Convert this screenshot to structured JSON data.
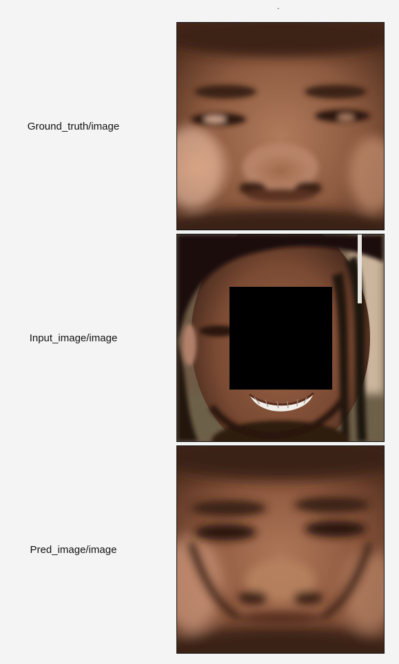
{
  "header": {
    "marker": "."
  },
  "rows": [
    {
      "label": "Ground_truth/image",
      "image": "ground-truth-face-closeup"
    },
    {
      "label": "Input_image/image",
      "image": "input-face-with-black-mask"
    },
    {
      "label": "Pred_image/image",
      "image": "predicted-blurry-face"
    }
  ]
}
